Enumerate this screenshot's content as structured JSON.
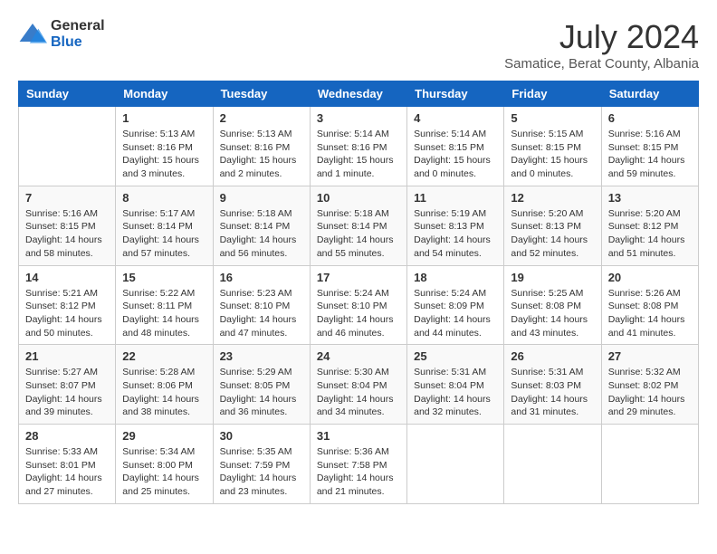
{
  "header": {
    "logo_general": "General",
    "logo_blue": "Blue",
    "month_year": "July 2024",
    "location": "Samatice, Berat County, Albania"
  },
  "days_of_week": [
    "Sunday",
    "Monday",
    "Tuesday",
    "Wednesday",
    "Thursday",
    "Friday",
    "Saturday"
  ],
  "weeks": [
    [
      {
        "day": "",
        "info": ""
      },
      {
        "day": "1",
        "info": "Sunrise: 5:13 AM\nSunset: 8:16 PM\nDaylight: 15 hours\nand 3 minutes."
      },
      {
        "day": "2",
        "info": "Sunrise: 5:13 AM\nSunset: 8:16 PM\nDaylight: 15 hours\nand 2 minutes."
      },
      {
        "day": "3",
        "info": "Sunrise: 5:14 AM\nSunset: 8:16 PM\nDaylight: 15 hours\nand 1 minute."
      },
      {
        "day": "4",
        "info": "Sunrise: 5:14 AM\nSunset: 8:15 PM\nDaylight: 15 hours\nand 0 minutes."
      },
      {
        "day": "5",
        "info": "Sunrise: 5:15 AM\nSunset: 8:15 PM\nDaylight: 15 hours\nand 0 minutes."
      },
      {
        "day": "6",
        "info": "Sunrise: 5:16 AM\nSunset: 8:15 PM\nDaylight: 14 hours\nand 59 minutes."
      }
    ],
    [
      {
        "day": "7",
        "info": "Sunrise: 5:16 AM\nSunset: 8:15 PM\nDaylight: 14 hours\nand 58 minutes."
      },
      {
        "day": "8",
        "info": "Sunrise: 5:17 AM\nSunset: 8:14 PM\nDaylight: 14 hours\nand 57 minutes."
      },
      {
        "day": "9",
        "info": "Sunrise: 5:18 AM\nSunset: 8:14 PM\nDaylight: 14 hours\nand 56 minutes."
      },
      {
        "day": "10",
        "info": "Sunrise: 5:18 AM\nSunset: 8:14 PM\nDaylight: 14 hours\nand 55 minutes."
      },
      {
        "day": "11",
        "info": "Sunrise: 5:19 AM\nSunset: 8:13 PM\nDaylight: 14 hours\nand 54 minutes."
      },
      {
        "day": "12",
        "info": "Sunrise: 5:20 AM\nSunset: 8:13 PM\nDaylight: 14 hours\nand 52 minutes."
      },
      {
        "day": "13",
        "info": "Sunrise: 5:20 AM\nSunset: 8:12 PM\nDaylight: 14 hours\nand 51 minutes."
      }
    ],
    [
      {
        "day": "14",
        "info": "Sunrise: 5:21 AM\nSunset: 8:12 PM\nDaylight: 14 hours\nand 50 minutes."
      },
      {
        "day": "15",
        "info": "Sunrise: 5:22 AM\nSunset: 8:11 PM\nDaylight: 14 hours\nand 48 minutes."
      },
      {
        "day": "16",
        "info": "Sunrise: 5:23 AM\nSunset: 8:10 PM\nDaylight: 14 hours\nand 47 minutes."
      },
      {
        "day": "17",
        "info": "Sunrise: 5:24 AM\nSunset: 8:10 PM\nDaylight: 14 hours\nand 46 minutes."
      },
      {
        "day": "18",
        "info": "Sunrise: 5:24 AM\nSunset: 8:09 PM\nDaylight: 14 hours\nand 44 minutes."
      },
      {
        "day": "19",
        "info": "Sunrise: 5:25 AM\nSunset: 8:08 PM\nDaylight: 14 hours\nand 43 minutes."
      },
      {
        "day": "20",
        "info": "Sunrise: 5:26 AM\nSunset: 8:08 PM\nDaylight: 14 hours\nand 41 minutes."
      }
    ],
    [
      {
        "day": "21",
        "info": "Sunrise: 5:27 AM\nSunset: 8:07 PM\nDaylight: 14 hours\nand 39 minutes."
      },
      {
        "day": "22",
        "info": "Sunrise: 5:28 AM\nSunset: 8:06 PM\nDaylight: 14 hours\nand 38 minutes."
      },
      {
        "day": "23",
        "info": "Sunrise: 5:29 AM\nSunset: 8:05 PM\nDaylight: 14 hours\nand 36 minutes."
      },
      {
        "day": "24",
        "info": "Sunrise: 5:30 AM\nSunset: 8:04 PM\nDaylight: 14 hours\nand 34 minutes."
      },
      {
        "day": "25",
        "info": "Sunrise: 5:31 AM\nSunset: 8:04 PM\nDaylight: 14 hours\nand 32 minutes."
      },
      {
        "day": "26",
        "info": "Sunrise: 5:31 AM\nSunset: 8:03 PM\nDaylight: 14 hours\nand 31 minutes."
      },
      {
        "day": "27",
        "info": "Sunrise: 5:32 AM\nSunset: 8:02 PM\nDaylight: 14 hours\nand 29 minutes."
      }
    ],
    [
      {
        "day": "28",
        "info": "Sunrise: 5:33 AM\nSunset: 8:01 PM\nDaylight: 14 hours\nand 27 minutes."
      },
      {
        "day": "29",
        "info": "Sunrise: 5:34 AM\nSunset: 8:00 PM\nDaylight: 14 hours\nand 25 minutes."
      },
      {
        "day": "30",
        "info": "Sunrise: 5:35 AM\nSunset: 7:59 PM\nDaylight: 14 hours\nand 23 minutes."
      },
      {
        "day": "31",
        "info": "Sunrise: 5:36 AM\nSunset: 7:58 PM\nDaylight: 14 hours\nand 21 minutes."
      },
      {
        "day": "",
        "info": ""
      },
      {
        "day": "",
        "info": ""
      },
      {
        "day": "",
        "info": ""
      }
    ]
  ]
}
